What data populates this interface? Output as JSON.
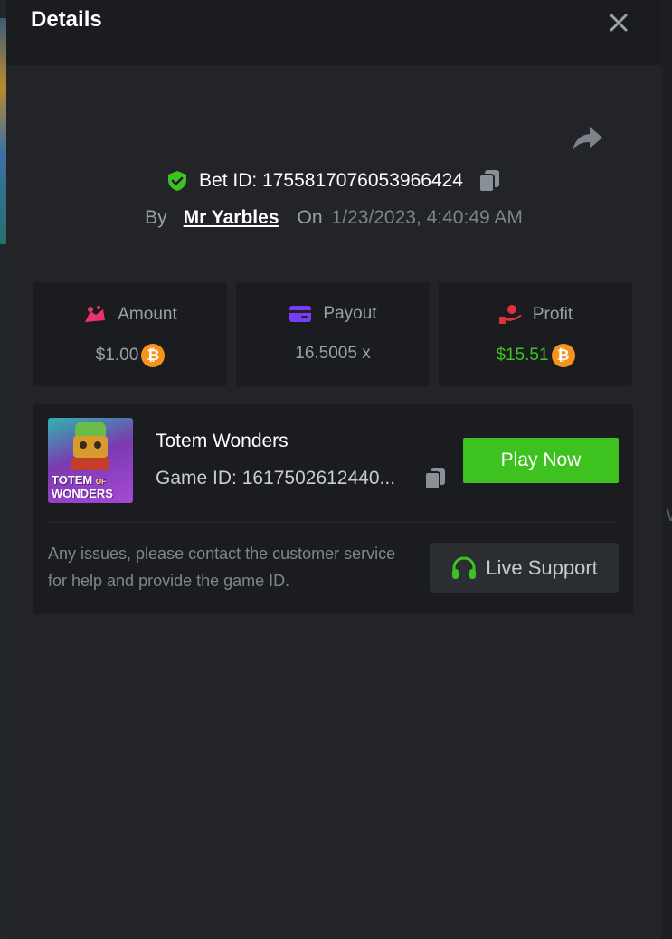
{
  "modal": {
    "title": "Details",
    "bet_id_text": "Bet ID: 1755817076053966424",
    "by_label": "By",
    "username": "Mr Yarbles",
    "on_label": "On",
    "date": "1/23/2023, 4:40:49 AM"
  },
  "stats": [
    {
      "label": "Amount",
      "value": "$1.00",
      "currency_icon": "bitcoin-icon",
      "icon": "amount-icon",
      "icon_color": "#e8336d"
    },
    {
      "label": "Payout",
      "value": "16.5005 x",
      "icon": "wallet-icon",
      "icon_color": "#7b3cf6"
    },
    {
      "label": "Profit",
      "value": "$15.51",
      "currency_icon": "bitcoin-icon",
      "icon": "profit-hand-icon",
      "icon_color": "#e0313b",
      "value_color": "#3dc21f"
    }
  ],
  "game": {
    "thumb_line1": "TOTEM",
    "thumb_of": "OF",
    "thumb_line2": "WONDERS",
    "name": "Totem Wonders",
    "game_id_text": "Game ID: 1617502612440...",
    "play_label": "Play Now",
    "help_text": "Any issues, please contact the customer service for help and provide the game ID.",
    "support_label": "Live Support"
  },
  "colors": {
    "accent_green": "#3dc21f",
    "panel_bg": "#232428",
    "card_bg": "#1b1c1f",
    "bitcoin": "#f7931a"
  }
}
